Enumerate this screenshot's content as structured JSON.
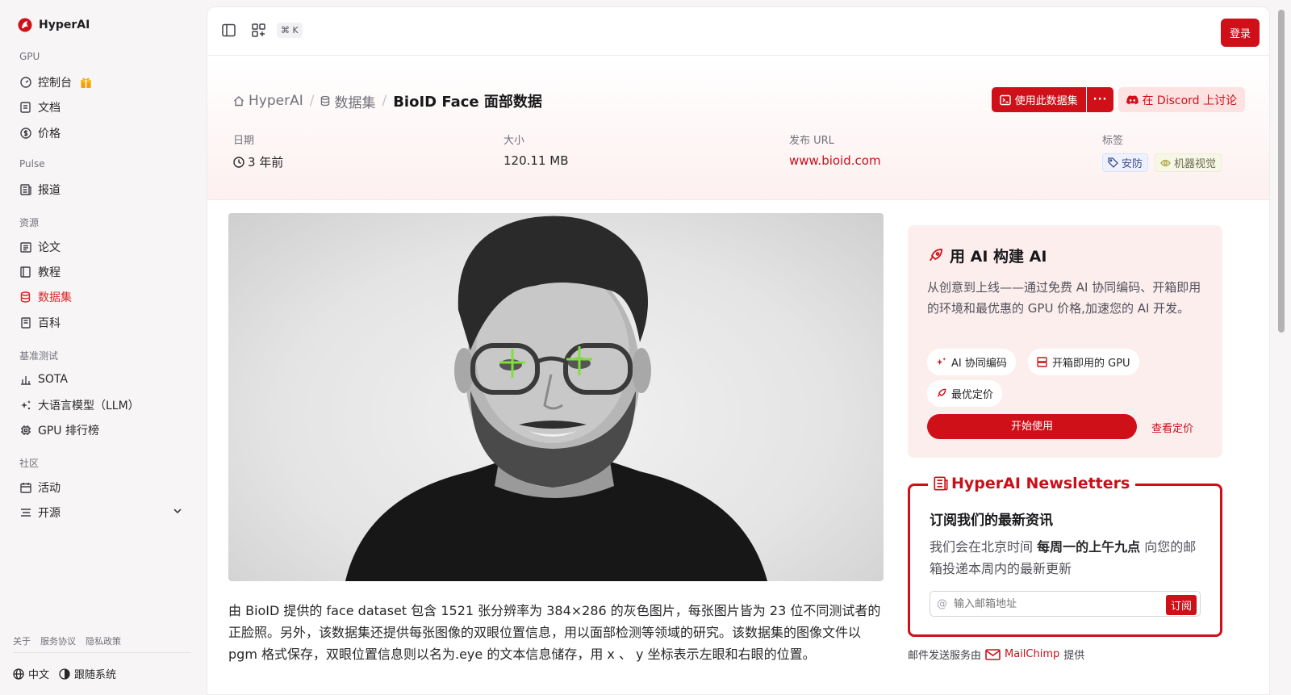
{
  "app": {
    "name": "HyperAI"
  },
  "sidebar": {
    "sections": {
      "gpu": "GPU",
      "pulse": "Pulse",
      "resources": "资源",
      "benchmark": "基准测试",
      "community": "社区"
    },
    "items": {
      "console": "控制台",
      "docs": "文档",
      "pricing": "价格",
      "news": "报道",
      "papers": "论文",
      "tutorials": "教程",
      "datasets": "数据集",
      "wiki": "百科",
      "sota": "SOTA",
      "llm": "大语言模型（LLM）",
      "gpu_rank": "GPU 排行榜",
      "events": "活动",
      "opensource": "开源"
    },
    "footer": {
      "about": "关于",
      "terms": "服务协议",
      "privacy": "隐私政策",
      "language": "中文",
      "theme": "跟随系统"
    }
  },
  "topbar": {
    "shortcut": "⌘ K",
    "login": "登录"
  },
  "breadcrumb": {
    "home": "HyperAI",
    "datasets": "数据集",
    "current": "BioID Face 面部数据"
  },
  "actions": {
    "use_dataset": "使用此数据集",
    "more": "···",
    "discord": "在 Discord 上讨论"
  },
  "meta": {
    "date_label": "日期",
    "date_value": "3 年前",
    "size_label": "大小",
    "size_value": "120.11 MB",
    "url_label": "发布 URL",
    "url_value": "www.bioid.com",
    "tags_label": "标签",
    "tags": [
      "安防",
      "机器视觉"
    ]
  },
  "description": "由 BioID 提供的 face dataset 包含 1521 张分辨率为 384×286 的灰色图片，每张图片皆为 23 位不同测试者的正脸照。另外，该数据集还提供每张图像的双眼位置信息，用以面部检测等领域的研究。该数据集的图像文件以 pgm 格式保存，双眼位置信息则以名为.eye 的文本信息储存，用 x 、 y 坐标表示左眼和右眼的位置。",
  "promo": {
    "title": "用 AI 构建 AI",
    "text": "从创意到上线——通过免费 AI 协同编码、开箱即用的环境和最优惠的 GPU 价格,加速您的 AI 开发。",
    "chips": [
      "AI 协同编码",
      "开箱即用的 GPU",
      "最优定价"
    ],
    "start": "开始使用",
    "pricing": "查看定价"
  },
  "newsletter": {
    "title": "HyperAI Newsletters",
    "heading": "订阅我们的最新资讯",
    "text_a": "我们会在北京时间 ",
    "text_b": "每周一的上午九点",
    "text_c": " 向您的邮箱投递本周内的最新更新",
    "placeholder": "输入邮箱地址",
    "subscribe": "订阅"
  },
  "mail_service": {
    "prefix": "邮件发送服务由",
    "provider": "MailChimp",
    "suffix": "提供"
  },
  "colors": {
    "accent": "#d01019",
    "link": "#c8101a",
    "marker": "#7fe03a"
  }
}
